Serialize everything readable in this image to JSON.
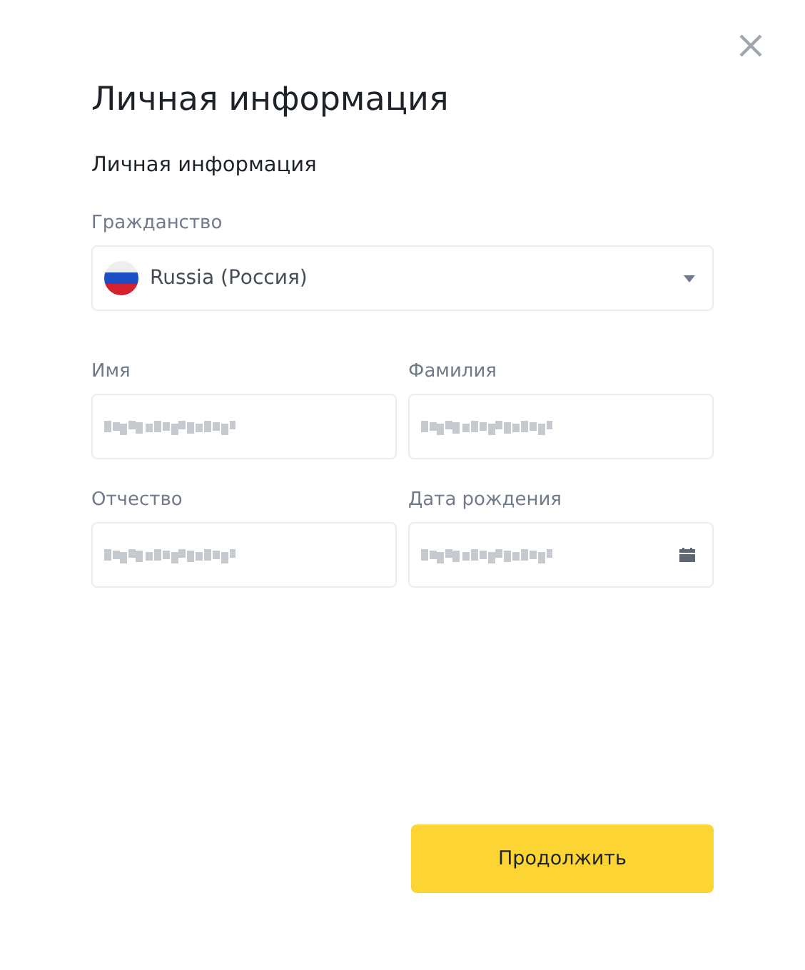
{
  "dialog": {
    "title": "Личная информация",
    "section_title": "Личная информация"
  },
  "citizenship": {
    "label": "Гражданство",
    "value": "Russia (Россия)"
  },
  "fields": [
    {
      "label": "Имя",
      "kind": "text",
      "redacted": true
    },
    {
      "label": "Фамилия",
      "kind": "text",
      "redacted": true
    },
    {
      "label": "Отчество",
      "kind": "text",
      "redacted": true
    },
    {
      "label": "Дата рождения",
      "kind": "date",
      "redacted": true
    }
  ],
  "buttons": [
    "Продолжить"
  ]
}
